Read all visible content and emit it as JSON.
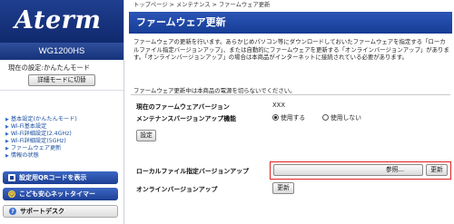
{
  "brand": {
    "logo": "Aterm",
    "model": "WG1200HS"
  },
  "mode": {
    "label": "現在の設定:かんたんモード",
    "button": "詳細モードに切替"
  },
  "nav": [
    "基本設定(かんたんモード)",
    "Wi-Fi基本設定",
    "Wi-Fi詳細設定(2.4GHz)",
    "Wi-Fi詳細設定(5GHz)",
    "ファームウェア更新",
    "情報の状態"
  ],
  "side_buttons": {
    "qr": "設定用QRコードを表示",
    "kids": "こども安心ネットタイマー",
    "support": "サポートデスク"
  },
  "breadcrumb": [
    "トップページ",
    "メンテナンス",
    "ファームウェア更新"
  ],
  "page_title": "ファームウェア更新",
  "description": "ファームウェアの更新を行います。あらかじめパソコン等にダウンロードしておいたファームウェアを指定する「ローカルファイル指定バージョンアップ」、または自動的にファームウェアを更新する「オンラインバージョンアップ」があります。「オンラインバージョンアップ」の場合は本商品がインターネットに接続されている必要があります。",
  "warning": "ファームウェア更新中は本商品の電源を切らないでください。",
  "firmware": {
    "label": "現在のファームウェアバージョン",
    "value": "XXX"
  },
  "maintenance": {
    "label": "メンテナンスバージョンアップ機能",
    "options": [
      "使用する",
      "使用しない"
    ],
    "selected": "使用する"
  },
  "setting_button": "設定",
  "local_update": {
    "label": "ローカルファイル指定バージョンアップ",
    "browse": "参照...",
    "update": "更新"
  },
  "online_update": {
    "label": "オンラインバージョンアップ",
    "update": "更新"
  },
  "colors": {
    "brand_blue": "#1a3a8c",
    "title_blue": "#1f4aa8",
    "link_blue": "#1a4fa0",
    "highlight_red": "#e02020"
  }
}
